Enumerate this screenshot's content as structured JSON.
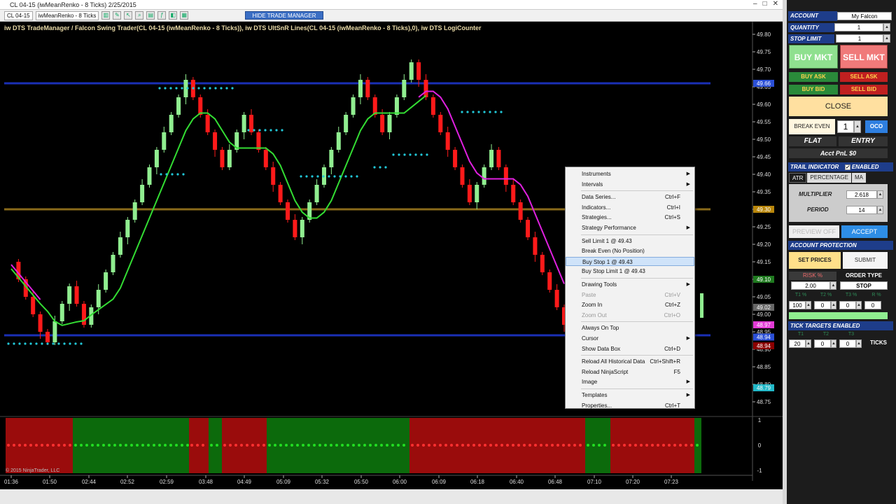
{
  "window": {
    "title": "CL 04-15 (iwMeanRenko - 8 Ticks)  2/25/2015"
  },
  "toolbar": {
    "instrument": "CL 04-15",
    "bar_type": "iwMeanRenko - 8 Ticks",
    "hide_trade_manager": "HIDE TRADE MANAGER"
  },
  "chart": {
    "title": "iw DTS TradeManager / Falcon Swing Trader(CL 04-15 (iwMeanRenko - 8 Ticks)), iw DTS UltSnR Lines(CL 04-15 (iwMeanRenko - 8 Ticks),0), iw DTS LogiCounter",
    "copyright": "© 2015 NinjaTrader, LLC",
    "price_axis": [
      "49.80",
      "49.75",
      "49.70",
      "49.65",
      "49.60",
      "49.55",
      "49.50",
      "49.45",
      "49.40",
      "49.35",
      "49.30",
      "49.25",
      "49.20",
      "49.15",
      "49.10",
      "49.05",
      "49.00",
      "48.95",
      "48.90",
      "48.85",
      "48.80",
      "48.75"
    ],
    "price_tags": [
      {
        "text": "49.66",
        "color": "#2b4fd6"
      },
      {
        "text": "49.30",
        "color": "#b8860b"
      },
      {
        "text": "49.10",
        "color": "#1f7a1f"
      },
      {
        "text": "49.02",
        "color": "#666666"
      },
      {
        "text": "48.97",
        "color": "#e23ad6"
      },
      {
        "text": "48.94",
        "color": "#2b4fd6"
      },
      {
        "text": "48.94",
        "color": "#8b0000"
      },
      {
        "text": "48.79",
        "color": "#21b8c8"
      }
    ],
    "osc_axis": [
      "1",
      "0",
      "-1"
    ],
    "time_axis": [
      "01:36",
      "01:50",
      "02:44",
      "02:52",
      "02:59",
      "03:48",
      "04:49",
      "05:09",
      "05:32",
      "05:50",
      "06:00",
      "06:09",
      "06:18",
      "06:40",
      "06:48",
      "07:10",
      "07:20",
      "07:23"
    ]
  },
  "context_menu": {
    "items": [
      {
        "label": "Instruments",
        "shortcut": "",
        "submenu": true,
        "disabled": false
      },
      {
        "label": "Intervals",
        "shortcut": "",
        "submenu": true,
        "disabled": false
      },
      {
        "sep": true
      },
      {
        "label": "Data Series...",
        "shortcut": "Ctrl+F",
        "submenu": false,
        "disabled": false
      },
      {
        "label": "Indicators...",
        "shortcut": "Ctrl+I",
        "submenu": false,
        "disabled": false
      },
      {
        "label": "Strategies...",
        "shortcut": "Ctrl+S",
        "submenu": false,
        "disabled": false
      },
      {
        "label": "Strategy Performance",
        "shortcut": "",
        "submenu": true,
        "disabled": false
      },
      {
        "sep": true
      },
      {
        "label": "Sell Limit 1 @ 49.43",
        "shortcut": "",
        "submenu": false,
        "disabled": false
      },
      {
        "label": "Break Even (No Position)",
        "shortcut": "",
        "submenu": false,
        "disabled": false
      },
      {
        "label": "Buy Stop 1 @ 49.43",
        "shortcut": "",
        "submenu": false,
        "disabled": false,
        "highlight": true
      },
      {
        "label": "Buy Stop Limit 1 @ 49.43",
        "shortcut": "",
        "submenu": false,
        "disabled": false
      },
      {
        "sep": true
      },
      {
        "label": "Drawing Tools",
        "shortcut": "",
        "submenu": true,
        "disabled": false
      },
      {
        "label": "Paste",
        "shortcut": "Ctrl+V",
        "submenu": false,
        "disabled": true
      },
      {
        "label": "Zoom In",
        "shortcut": "Ctrl+Z",
        "submenu": false,
        "disabled": false
      },
      {
        "label": "Zoom Out",
        "shortcut": "Ctrl+O",
        "submenu": false,
        "disabled": true
      },
      {
        "sep": true
      },
      {
        "label": "Always On Top",
        "shortcut": "",
        "submenu": false,
        "disabled": false
      },
      {
        "label": "Cursor",
        "shortcut": "",
        "submenu": true,
        "disabled": false
      },
      {
        "label": "Show Data Box",
        "shortcut": "Ctrl+D",
        "submenu": false,
        "disabled": false
      },
      {
        "sep": true
      },
      {
        "label": "Reload All Historical Data",
        "shortcut": "Ctrl+Shift+R",
        "submenu": false,
        "disabled": false
      },
      {
        "label": "Reload NinjaScript",
        "shortcut": "F5",
        "submenu": false,
        "disabled": false
      },
      {
        "label": "Image",
        "shortcut": "",
        "submenu": true,
        "disabled": false
      },
      {
        "sep": true
      },
      {
        "label": "Templates",
        "shortcut": "",
        "submenu": true,
        "disabled": false
      },
      {
        "label": "Properties...",
        "shortcut": "Ctrl+T",
        "submenu": false,
        "disabled": false
      }
    ]
  },
  "panel": {
    "account_label": "ACCOUNT",
    "account_value": "My Falcon",
    "quantity_label": "QUANTITY",
    "quantity_value": "1",
    "stop_limit_label": "STOP LIMIT TICKS",
    "stop_limit_value": "1",
    "buy_mkt": "BUY MKT",
    "sell_mkt": "SELL MKT",
    "buy_ask": "BUY ASK",
    "sell_ask": "SELL ASK",
    "buy_bid": "BUY BID",
    "sell_bid": "SELL BID",
    "close": "CLOSE",
    "break_even": "BREAK EVEN",
    "break_even_value": "1",
    "oco": "OCO",
    "flat": "FLAT",
    "entry": "ENTRY",
    "acct_pnl": "Acct PnL $0",
    "trail_indicator": "TRAIL INDICATOR",
    "enabled": "ENABLED",
    "tabs": [
      "ATR",
      "PERCENTAGE",
      "MA"
    ],
    "multiplier_label": "MULTIPLIER",
    "multiplier_value": "2.618",
    "period_label": "PERIOD",
    "period_value": "14",
    "preview_off": "PREVIEW OFF",
    "accept": "ACCEPT",
    "account_protection": "ACCOUNT PROTECTION",
    "set_prices": "SET PRICES",
    "submit": "SUBMIT",
    "risk_label": "RISK %",
    "order_type_label": "ORDER TYPE",
    "risk_value": "2.00",
    "order_type_value": "STOP",
    "target_headers": [
      "T1 %",
      "T2 %",
      "T3 %",
      "R %"
    ],
    "target_values": [
      "100",
      "0",
      "0",
      "0"
    ],
    "tick_targets": "TICK TARGETS ENABLED",
    "tick_headers": [
      "T1",
      "T2",
      "T3"
    ],
    "tick_values": [
      "20",
      "0",
      "0"
    ],
    "ticks_label": "TICKS"
  },
  "colors": {
    "up_candle": "#90ee90",
    "down_candle": "#ff1a1a",
    "buy_mkt_bg": "#8fe08f",
    "sell_mkt_bg": "#f07a7a",
    "close_bg": "#ffe0a0",
    "accept_bg": "#2e8ee6"
  }
}
